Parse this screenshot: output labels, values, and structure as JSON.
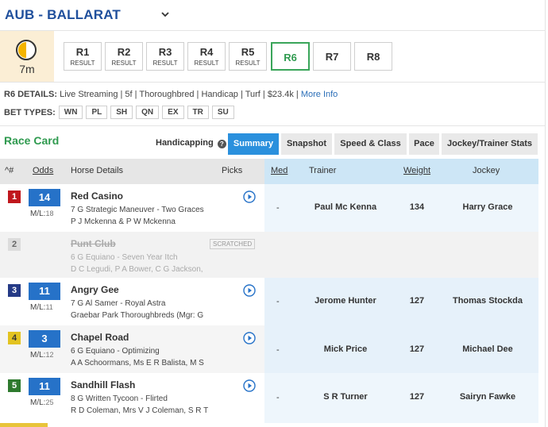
{
  "venue": {
    "title": "AUB - BALLARAT"
  },
  "timer": {
    "label": "7m"
  },
  "races": [
    {
      "label": "R1",
      "status": "RESULT"
    },
    {
      "label": "R2",
      "status": "RESULT"
    },
    {
      "label": "R3",
      "status": "RESULT"
    },
    {
      "label": "R4",
      "status": "RESULT"
    },
    {
      "label": "R5",
      "status": "RESULT"
    },
    {
      "label": "R6",
      "status": ""
    },
    {
      "label": "R7",
      "status": ""
    },
    {
      "label": "R8",
      "status": ""
    }
  ],
  "details": {
    "label": "R6 DETAILS:",
    "text": "Live Streaming | 5f | Thoroughbred | Handicap | Turf | $23.4k |",
    "more": "More Info"
  },
  "bet_types": {
    "label": "BET TYPES:",
    "items": [
      "WN",
      "PL",
      "SH",
      "QN",
      "EX",
      "TR",
      "SU"
    ]
  },
  "race_card": {
    "title": "Race Card",
    "handicapping": "Handicapping",
    "help": "?",
    "tabs": [
      "Summary",
      "Snapshot",
      "Speed & Class",
      "Pace",
      "Jockey/Trainer Stats"
    ],
    "active_tab": "Summary"
  },
  "columns": {
    "num": "^#",
    "odds": "Odds",
    "horse": "Horse Details",
    "picks": "Picks",
    "med": "Med",
    "trainer": "Trainer",
    "weight": "Weight",
    "jockey": "Jockey"
  },
  "runners": [
    {
      "num": "1",
      "num_color": "#c0171d",
      "odds": "14",
      "ml_label": "M/L:",
      "ml": "18",
      "name": "Red Casino",
      "line1": "7 G Strategic Maneuver - Two Graces",
      "line2": "P J Mckenna & P W Mckenna",
      "med": "-",
      "trainer": "Paul Mc Kenna",
      "weight": "134",
      "jockey": "Harry Grace",
      "scratched": false
    },
    {
      "num": "2",
      "num_color": "#dcdcdc",
      "odds": "",
      "ml_label": "",
      "ml": "",
      "name": "Punt Club",
      "line1": "6 G Equiano - Seven Year Itch",
      "line2": "D C Legudi, P A Bower, C G Jackson,",
      "med": "",
      "trainer": "",
      "weight": "",
      "jockey": "",
      "scratched": true,
      "scratched_label": "SCRATCHED"
    },
    {
      "num": "3",
      "num_color": "#253a86",
      "odds": "11",
      "ml_label": "M/L:",
      "ml": "11",
      "name": "Angry Gee",
      "line1": "7 G Al Samer - Royal Astra",
      "line2": "Graebar Park Thoroughbreds (Mgr: G",
      "med": "-",
      "trainer": "Jerome Hunter",
      "weight": "127",
      "jockey": "Thomas Stockda",
      "scratched": false
    },
    {
      "num": "4",
      "num_color": "#e3c320",
      "odds": "3",
      "ml_label": "M/L:",
      "ml": "12",
      "name": "Chapel Road",
      "line1": "6 G Equiano - Optimizing",
      "line2": "A A Schoormans, Ms E R Balista, M S",
      "med": "-",
      "trainer": "Mick Price",
      "weight": "127",
      "jockey": "Michael Dee",
      "scratched": false
    },
    {
      "num": "5",
      "num_color": "#2e7a2e",
      "odds": "11",
      "ml_label": "M/L:",
      "ml": "25",
      "name": "Sandhill Flash",
      "line1": "8 G Written Tycoon - Flirted",
      "line2": "R D Coleman, Mrs V J Coleman, S R T",
      "med": "-",
      "trainer": "S R Turner",
      "weight": "127",
      "jockey": "Sairyn Fawke",
      "scratched": false
    }
  ],
  "colors": {
    "accent": "#2a90dd",
    "green": "#2f9a4f",
    "link": "#1f4f9c",
    "odds": "#2672c8"
  }
}
